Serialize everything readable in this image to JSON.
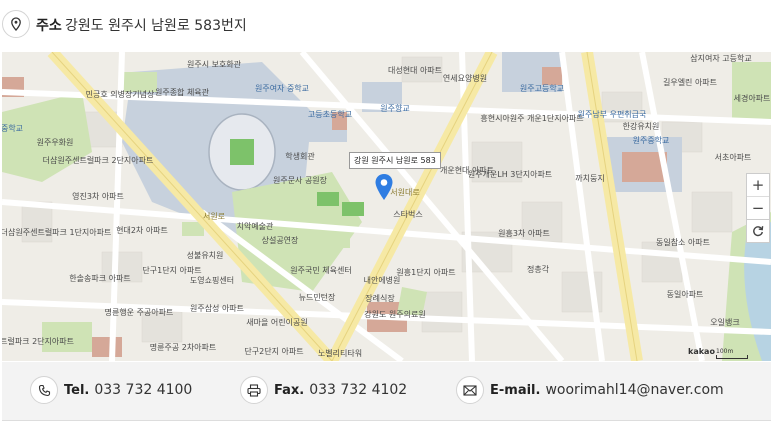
{
  "address": {
    "key": "주소",
    "value": "강원도 원주시 남원로 583번지"
  },
  "map": {
    "callout": "강원 원주시 남원로 583",
    "zoom_in": "+",
    "zoom_out": "−",
    "brand": "kakao",
    "scale_label": "100m",
    "labels": {
      "l1": "원주시 보호화관",
      "l2": "원주종합 체육관",
      "l3": "원주여자 중학교",
      "l4": "대성현대 아파트",
      "l5": "연세요양병원",
      "l6": "원주고등학교",
      "l7": "삼지여자 고등학교",
      "l8": "길우엘린 아파트",
      "l9": "세경아파트",
      "l10": "민긍호 의병장기념상",
      "l11": "고등초등학교",
      "l12": "원주향교",
      "l13": "흥현시아원주 개운1단지아파트",
      "l14": "원주남부 우편취급국",
      "l15": "한강유치원",
      "l16": "원주중학교",
      "l17": "서초아파트",
      "l18": "원주우화원",
      "l19": "더샵원주센트럴파크 2단지아파트",
      "l20": "학생회관",
      "l21": "원주문사 공원장",
      "l22": "개운현대 아파트",
      "l23": "원주개운LH 3단지아파트",
      "l24": "까치둥지",
      "l25": "스타벅스",
      "l26": "영진3차 아파트",
      "l27": "치악예술관",
      "l28": "더샵원주센트럴파크 1단지아파트",
      "l29": "현대2차 아파트",
      "l30": "상설공연장",
      "l31": "원흥3차 아파트",
      "l32": "동일참소 아파트",
      "l33": "성불유치원",
      "l34": "정총각",
      "l35": "한솔송파크 아파트",
      "l36": "단구1단지 아파트",
      "l37": "도영쇼핑센터",
      "l38": "원주국민 체육센터",
      "l39": "내안에병원",
      "l40": "원흥1단지 아파트",
      "l41": "동일아파트",
      "l42": "뉴드민턴장",
      "l43": "명륜행운 주공아파트",
      "l44": "원주삼성 아파트",
      "l45": "장례식장",
      "l46": "강원도 원주의료원",
      "l47": "오일뱅크",
      "l48": "새마을 어린이공원",
      "l49": "명륜주공 2차아파트",
      "l50": "단구2단지 아파트",
      "l51": "노벨리티타워",
      "l52": "원주센트럴파크 2단지아파트",
      "l53": "중학교",
      "l54": "서원로",
      "l55": "서원대로"
    }
  },
  "contact": {
    "tel": {
      "key": "Tel.",
      "value": "033 732 4100"
    },
    "fax": {
      "key": "Fax.",
      "value": "033 732 4102"
    },
    "email": {
      "key": "E-mail.",
      "value": "woorimahl14@naver.com"
    }
  },
  "icons": {
    "address": "map-pin-icon",
    "tel": "phone-icon",
    "fax": "printer-icon",
    "email": "envelope-icon",
    "marker": "location-marker-icon",
    "refresh": "refresh-icon"
  },
  "colors": {
    "road_yellow": "#f6e9a5",
    "map_bg": "#efede7",
    "park_green": "#cfe3b5",
    "marker_blue": "#2f7de2"
  }
}
